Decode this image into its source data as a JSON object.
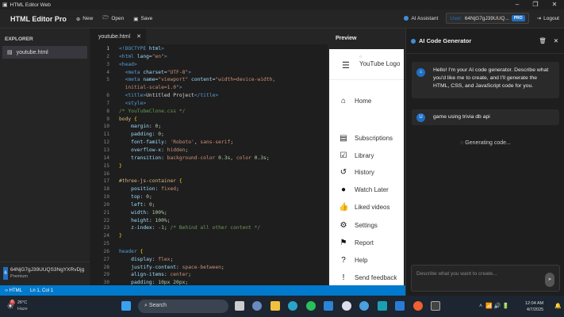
{
  "window": {
    "title": "HTML Editor Web"
  },
  "header": {
    "brand": "HTML Editor Pro",
    "new": "New",
    "open": "Open",
    "save": "Save",
    "ai_assistant": "AI Assistant",
    "user_label": "User:",
    "user_id": "64NjG7gJ39UUQ...",
    "plan_badge": "PRO",
    "logout": "Logout"
  },
  "explorer": {
    "title": "EXPLORER",
    "files": [
      "youtube.html"
    ],
    "user_name": "64NjG7gJ39UUQS3NgYXRvDjg",
    "user_plan": "Premium",
    "user_badge": "6"
  },
  "editor": {
    "tab": "youtube.html",
    "lines": [
      [
        "1",
        [
          [
            "tag",
            "<!DOCTYPE "
          ],
          [
            "attr",
            "html"
          ],
          [
            "tag",
            ">"
          ]
        ]
      ],
      [
        "2",
        [
          [
            "tag",
            "<html "
          ],
          [
            "attr",
            "lang"
          ],
          [
            "pl",
            "="
          ],
          [
            "str",
            "\"en\""
          ],
          [
            "tag",
            ">"
          ]
        ]
      ],
      [
        "3",
        [
          [
            "tag",
            "<head>"
          ]
        ]
      ],
      [
        "4",
        [
          [
            "pl",
            "  "
          ],
          [
            "tag",
            "<meta "
          ],
          [
            "attr",
            "charset"
          ],
          [
            "pl",
            "="
          ],
          [
            "str",
            "\"UTF-8\""
          ],
          [
            "tag",
            ">"
          ]
        ]
      ],
      [
        "5",
        [
          [
            "pl",
            "  "
          ],
          [
            "tag",
            "<meta "
          ],
          [
            "attr",
            "name"
          ],
          [
            "pl",
            "="
          ],
          [
            "str",
            "\"viewport\""
          ],
          [
            "attr",
            " content"
          ],
          [
            "pl",
            "="
          ],
          [
            "str",
            "\"width=device-width,"
          ]
        ]
      ],
      [
        "",
        [
          [
            "str",
            "  initial-scale=1.0\""
          ],
          [
            "tag",
            ">"
          ]
        ]
      ],
      [
        "6",
        [
          [
            "pl",
            "  "
          ],
          [
            "tag",
            "<title>"
          ],
          [
            "pl",
            "Untitled Project"
          ],
          [
            "tag",
            "</title>"
          ]
        ]
      ],
      [
        "7",
        [
          [
            "pl",
            "  "
          ],
          [
            "tag",
            "<style>"
          ]
        ]
      ],
      [
        "8",
        [
          [
            "cmt",
            "/* YouTubeClone.css */"
          ]
        ]
      ],
      [
        "9",
        [
          [
            "sel",
            "body "
          ],
          [
            "br",
            "{"
          ]
        ]
      ],
      [
        "10",
        [
          [
            "prop",
            "    margin"
          ],
          [
            "pl",
            ": "
          ],
          [
            "numv",
            "0"
          ],
          [
            "pl",
            ";"
          ]
        ]
      ],
      [
        "11",
        [
          [
            "prop",
            "    padding"
          ],
          [
            "pl",
            ": "
          ],
          [
            "numv",
            "0"
          ],
          [
            "pl",
            ";"
          ]
        ]
      ],
      [
        "12",
        [
          [
            "prop",
            "    font-family"
          ],
          [
            "pl",
            ": "
          ],
          [
            "str",
            "'Roboto'"
          ],
          [
            "pl",
            ", "
          ],
          [
            "str",
            "sans-serif"
          ],
          [
            "pl",
            ";"
          ]
        ]
      ],
      [
        "13",
        [
          [
            "prop",
            "    overflow-x"
          ],
          [
            "pl",
            ": "
          ],
          [
            "str",
            "hidden"
          ],
          [
            "pl",
            ";"
          ]
        ]
      ],
      [
        "14",
        [
          [
            "prop",
            "    transition"
          ],
          [
            "pl",
            ": "
          ],
          [
            "str",
            "background-color "
          ],
          [
            "numv",
            "0.3s"
          ],
          [
            "pl",
            ", "
          ],
          [
            "str",
            "color "
          ],
          [
            "numv",
            "0.3s"
          ],
          [
            "pl",
            ";"
          ]
        ]
      ],
      [
        "15",
        [
          [
            "br",
            "}"
          ]
        ]
      ],
      [
        "16",
        []
      ],
      [
        "17",
        [
          [
            "sel",
            "#three-js-container "
          ],
          [
            "br",
            "{"
          ]
        ]
      ],
      [
        "18",
        [
          [
            "prop",
            "    position"
          ],
          [
            "pl",
            ": "
          ],
          [
            "str",
            "fixed"
          ],
          [
            "pl",
            ";"
          ]
        ]
      ],
      [
        "19",
        [
          [
            "prop",
            "    top"
          ],
          [
            "pl",
            ": "
          ],
          [
            "numv",
            "0"
          ],
          [
            "pl",
            ";"
          ]
        ]
      ],
      [
        "20",
        [
          [
            "prop",
            "    left"
          ],
          [
            "pl",
            ": "
          ],
          [
            "numv",
            "0"
          ],
          [
            "pl",
            ";"
          ]
        ]
      ],
      [
        "21",
        [
          [
            "prop",
            "    width"
          ],
          [
            "pl",
            ": "
          ],
          [
            "numv",
            "100%"
          ],
          [
            "pl",
            ";"
          ]
        ]
      ],
      [
        "22",
        [
          [
            "prop",
            "    height"
          ],
          [
            "pl",
            ": "
          ],
          [
            "numv",
            "100%"
          ],
          [
            "pl",
            ";"
          ]
        ]
      ],
      [
        "23",
        [
          [
            "prop",
            "    z-index"
          ],
          [
            "pl",
            ": "
          ],
          [
            "numv",
            "-1"
          ],
          [
            "pl",
            "; "
          ],
          [
            "cmt",
            "/* Behind all other content */"
          ]
        ]
      ],
      [
        "24",
        [
          [
            "br",
            "}"
          ]
        ]
      ],
      [
        "25",
        []
      ],
      [
        "26",
        [
          [
            "kw",
            "header "
          ],
          [
            "br",
            "{"
          ]
        ]
      ],
      [
        "27",
        [
          [
            "prop",
            "    display"
          ],
          [
            "pl",
            ": "
          ],
          [
            "str",
            "flex"
          ],
          [
            "pl",
            ";"
          ]
        ]
      ],
      [
        "28",
        [
          [
            "prop",
            "    justify-content"
          ],
          [
            "pl",
            ": "
          ],
          [
            "str",
            "space-between"
          ],
          [
            "pl",
            ";"
          ]
        ]
      ],
      [
        "29",
        [
          [
            "prop",
            "    align-items"
          ],
          [
            "pl",
            ": "
          ],
          [
            "str",
            "center"
          ],
          [
            "pl",
            ";"
          ]
        ]
      ],
      [
        "30",
        [
          [
            "prop",
            "    padding"
          ],
          [
            "pl",
            ": "
          ],
          [
            "numv",
            "10px 20px"
          ],
          [
            "pl",
            ";"
          ]
        ]
      ]
    ]
  },
  "preview": {
    "title": "Preview",
    "logo_alt": "YouTube Logo",
    "nav": [
      {
        "label": "Home",
        "icon": "home-icon",
        "glyph": "⌂"
      },
      {
        "label": "Subscriptions",
        "icon": "subscriptions-icon",
        "glyph": "▤"
      },
      {
        "label": "Library",
        "icon": "library-icon",
        "glyph": "☑"
      },
      {
        "label": "History",
        "icon": "history-icon",
        "glyph": "↺"
      },
      {
        "label": "Watch Later",
        "icon": "clock-icon",
        "glyph": "●"
      },
      {
        "label": "Liked videos",
        "icon": "thumbs-up-icon",
        "glyph": "👍"
      },
      {
        "label": "Settings",
        "icon": "gear-icon",
        "glyph": "⚙"
      },
      {
        "label": "Report",
        "icon": "flag-icon",
        "glyph": "⚑"
      },
      {
        "label": "Help",
        "icon": "help-icon",
        "glyph": "?"
      },
      {
        "label": "Send feedback",
        "icon": "feedback-icon",
        "glyph": "!"
      }
    ]
  },
  "ai": {
    "title": "AI Code Generator",
    "messages": [
      {
        "role": "assistant",
        "avatar": "⌂",
        "text": "Hello! I'm your AI code generator. Describe what you'd like me to create, and I'll generate the HTML, CSS, and JavaScript code for you."
      },
      {
        "role": "user",
        "avatar": "U",
        "text": "game using trivia db api"
      }
    ],
    "status": "Generating code...",
    "input_placeholder": "Describe what you want to create..."
  },
  "statusbar": {
    "language": "HTML",
    "position": "Ln 1, Col 1"
  },
  "taskbar": {
    "temp": "26°C",
    "weather": "Haze",
    "weather_badge": "6",
    "search": "Search",
    "time": "12:04 AM",
    "date": "4/7/2025"
  },
  "colors": {
    "accent": "#007acc",
    "pro": "#1f6fc4"
  }
}
